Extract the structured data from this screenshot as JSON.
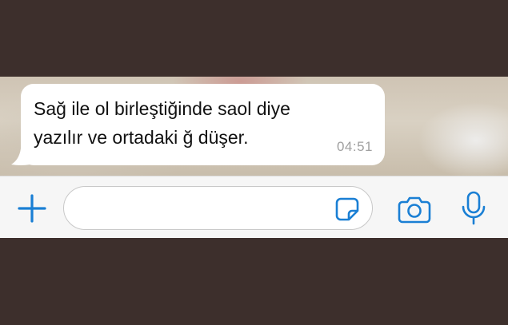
{
  "chat": {
    "message": {
      "text": "Sağ ile ol birleştiğinde saol diye yazılır ve ortadaki ğ düşer.",
      "time": "04:51"
    }
  },
  "input_bar": {
    "message_field_value": "",
    "icons": {
      "attach": "plus-icon",
      "sticker": "sticker-icon",
      "camera": "camera-icon",
      "microphone": "microphone-icon"
    }
  },
  "colors": {
    "accent": "#1a7fd4",
    "bubble": "#ffffff",
    "timestamp": "#a0a0a0",
    "frame": "#3d2f2c",
    "input_bar": "#f6f6f6"
  }
}
